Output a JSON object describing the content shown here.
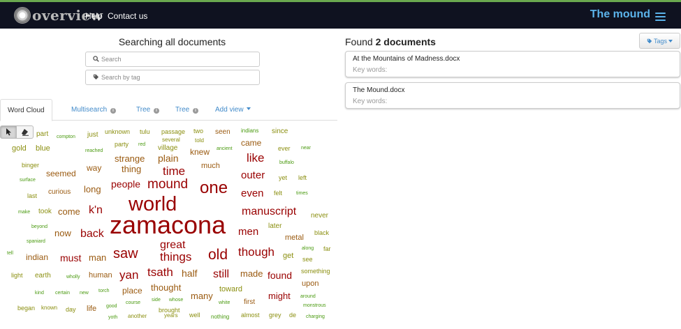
{
  "nav": {
    "brand": "overview",
    "links": [
      "Help",
      "Contact us"
    ],
    "document_set_title": "The mound"
  },
  "search": {
    "heading": "Searching all documents",
    "search_placeholder": "Search",
    "tag_placeholder": "Search by tag"
  },
  "tabs": [
    {
      "label": "Word Cloud"
    },
    {
      "label": "Multisearch"
    },
    {
      "label": "Tree"
    },
    {
      "label": "Tree"
    },
    {
      "label": "Add view"
    }
  ],
  "results": {
    "found_prefix": "Found",
    "found_count": "2 documents",
    "tags_button": "Tags",
    "documents": [
      {
        "title": "At the Mountains of Madness.docx",
        "keywords_label": "Key words:"
      },
      {
        "title": "The Mound.docx",
        "keywords_label": "Key words:"
      }
    ]
  },
  "colors": {
    "navbar": "#0f1220",
    "accent": "#5bb3ea",
    "link": "#428bca",
    "word_red": "#990000",
    "word_brown": "#9a5a10",
    "word_olive": "#8b8f10",
    "word_green": "#4a9a10"
  },
  "word_cloud": [
    {
      "text": "part",
      "color": "#8b8f10"
    },
    {
      "text": "compton",
      "color": "#4a9a10"
    },
    {
      "text": "just",
      "color": "#8b8f10"
    },
    {
      "text": "unknown",
      "color": "#8b8f10"
    },
    {
      "text": "tulu",
      "color": "#8b8f10"
    },
    {
      "text": "passage",
      "color": "#8b8f10"
    },
    {
      "text": "two",
      "color": "#8b8f10"
    },
    {
      "text": "seen",
      "color": "#9a5a10"
    },
    {
      "text": "indians",
      "color": "#4a9a10"
    },
    {
      "text": "since",
      "color": "#8b8f10"
    },
    {
      "text": "gold",
      "color": "#8b8f10"
    },
    {
      "text": "blue",
      "color": "#8b8f10"
    },
    {
      "text": "party",
      "color": "#8b8f10"
    },
    {
      "text": "red",
      "color": "#4a9a10"
    },
    {
      "text": "several",
      "color": "#8b8f10"
    },
    {
      "text": "told",
      "color": "#8b8f10"
    },
    {
      "text": "came",
      "color": "#9a5a10"
    },
    {
      "text": "reached",
      "color": "#4a9a10"
    },
    {
      "text": "village",
      "color": "#8b8f10"
    },
    {
      "text": "knew",
      "color": "#9a5a10"
    },
    {
      "text": "ancient",
      "color": "#4a9a10"
    },
    {
      "text": "ever",
      "color": "#8b8f10"
    },
    {
      "text": "near",
      "color": "#4a9a10"
    },
    {
      "text": "strange",
      "color": "#9a5a10"
    },
    {
      "text": "plain",
      "color": "#9a5a10"
    },
    {
      "text": "like",
      "color": "#990000"
    },
    {
      "text": "binger",
      "color": "#8b8f10"
    },
    {
      "text": "buffalo",
      "color": "#4a9a10"
    },
    {
      "text": "way",
      "color": "#9a5a10"
    },
    {
      "text": "thing",
      "color": "#9a5a10"
    },
    {
      "text": "time",
      "color": "#990000"
    },
    {
      "text": "much",
      "color": "#9a5a10"
    },
    {
      "text": "seemed",
      "color": "#9a5a10"
    },
    {
      "text": "outer",
      "color": "#990000"
    },
    {
      "text": "surface",
      "color": "#4a9a10"
    },
    {
      "text": "yet",
      "color": "#8b8f10"
    },
    {
      "text": "left",
      "color": "#8b8f10"
    },
    {
      "text": "people",
      "color": "#990000"
    },
    {
      "text": "mound",
      "color": "#990000"
    },
    {
      "text": "one",
      "color": "#990000"
    },
    {
      "text": "long",
      "color": "#9a5a10"
    },
    {
      "text": "curious",
      "color": "#9a5a10"
    },
    {
      "text": "even",
      "color": "#990000"
    },
    {
      "text": "felt",
      "color": "#8b8f10"
    },
    {
      "text": "times",
      "color": "#4a9a10"
    },
    {
      "text": "last",
      "color": "#8b8f10"
    },
    {
      "text": "world",
      "color": "#990000"
    },
    {
      "text": "make",
      "color": "#4a9a10"
    },
    {
      "text": "took",
      "color": "#8b8f10"
    },
    {
      "text": "come",
      "color": "#9a5a10"
    },
    {
      "text": "k'n",
      "color": "#990000"
    },
    {
      "text": "manuscript",
      "color": "#990000"
    },
    {
      "text": "never",
      "color": "#8b8f10"
    },
    {
      "text": "beyond",
      "color": "#4a9a10"
    },
    {
      "text": "zamacona",
      "color": "#990000"
    },
    {
      "text": "later",
      "color": "#8b8f10"
    },
    {
      "text": "now",
      "color": "#9a5a10"
    },
    {
      "text": "back",
      "color": "#990000"
    },
    {
      "text": "men",
      "color": "#990000"
    },
    {
      "text": "black",
      "color": "#8b8f10"
    },
    {
      "text": "spaniard",
      "color": "#4a9a10"
    },
    {
      "text": "metal",
      "color": "#9a5a10"
    },
    {
      "text": "great",
      "color": "#990000"
    },
    {
      "text": "along",
      "color": "#4a9a10"
    },
    {
      "text": "far",
      "color": "#8b8f10"
    },
    {
      "text": "tell",
      "color": "#4a9a10"
    },
    {
      "text": "indian",
      "color": "#9a5a10"
    },
    {
      "text": "must",
      "color": "#990000"
    },
    {
      "text": "man",
      "color": "#9a5a10"
    },
    {
      "text": "saw",
      "color": "#990000"
    },
    {
      "text": "things",
      "color": "#990000"
    },
    {
      "text": "old",
      "color": "#990000"
    },
    {
      "text": "though",
      "color": "#990000"
    },
    {
      "text": "get",
      "color": "#8b8f10"
    },
    {
      "text": "see",
      "color": "#8b8f10"
    },
    {
      "text": "light",
      "color": "#8b8f10"
    },
    {
      "text": "earth",
      "color": "#8b8f10"
    },
    {
      "text": "wholly",
      "color": "#4a9a10"
    },
    {
      "text": "human",
      "color": "#9a5a10"
    },
    {
      "text": "yan",
      "color": "#990000"
    },
    {
      "text": "tsath",
      "color": "#990000"
    },
    {
      "text": "half",
      "color": "#9a5a10"
    },
    {
      "text": "still",
      "color": "#990000"
    },
    {
      "text": "made",
      "color": "#9a5a10"
    },
    {
      "text": "found",
      "color": "#990000"
    },
    {
      "text": "something",
      "color": "#8b8f10"
    },
    {
      "text": "upon",
      "color": "#9a5a10"
    },
    {
      "text": "thought",
      "color": "#9a5a10"
    },
    {
      "text": "toward",
      "color": "#8b8f10"
    },
    {
      "text": "kind",
      "color": "#4a9a10"
    },
    {
      "text": "certain",
      "color": "#4a9a10"
    },
    {
      "text": "new",
      "color": "#4a9a10"
    },
    {
      "text": "torch",
      "color": "#4a9a10"
    },
    {
      "text": "place",
      "color": "#9a5a10"
    },
    {
      "text": "many",
      "color": "#9a5a10"
    },
    {
      "text": "might",
      "color": "#990000"
    },
    {
      "text": "around",
      "color": "#4a9a10"
    },
    {
      "text": "course",
      "color": "#4a9a10"
    },
    {
      "text": "side",
      "color": "#4a9a10"
    },
    {
      "text": "whose",
      "color": "#4a9a10"
    },
    {
      "text": "white",
      "color": "#4a9a10"
    },
    {
      "text": "first",
      "color": "#9a5a10"
    },
    {
      "text": "began",
      "color": "#8b8f10"
    },
    {
      "text": "known",
      "color": "#8b8f10"
    },
    {
      "text": "day",
      "color": "#8b8f10"
    },
    {
      "text": "life",
      "color": "#9a5a10"
    },
    {
      "text": "good",
      "color": "#4a9a10"
    },
    {
      "text": "brought",
      "color": "#8b8f10"
    },
    {
      "text": "monstrous",
      "color": "#4a9a10"
    },
    {
      "text": "yoth",
      "color": "#4a9a10"
    },
    {
      "text": "another",
      "color": "#8b8f10"
    },
    {
      "text": "years",
      "color": "#8b8f10"
    },
    {
      "text": "well",
      "color": "#8b8f10"
    },
    {
      "text": "nothing",
      "color": "#4a9a10"
    },
    {
      "text": "almost",
      "color": "#8b8f10"
    },
    {
      "text": "grey",
      "color": "#8b8f10"
    },
    {
      "text": "de",
      "color": "#8b8f10"
    },
    {
      "text": "charging",
      "color": "#4a9a10"
    }
  ]
}
